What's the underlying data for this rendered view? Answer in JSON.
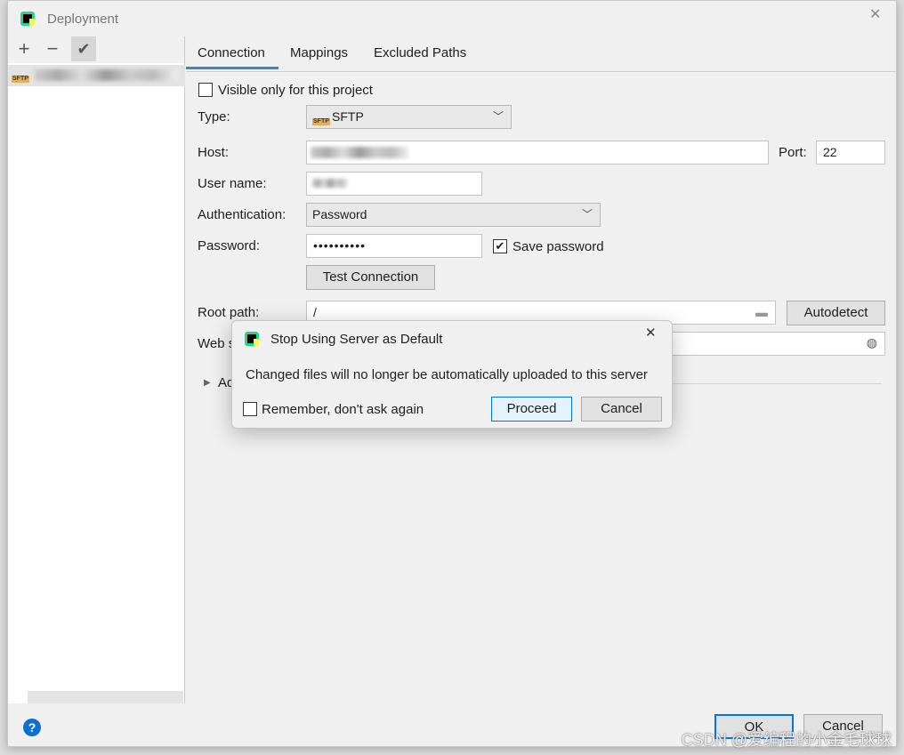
{
  "window": {
    "title": "Deployment",
    "close": "✕"
  },
  "toolbar": {
    "add": "+",
    "remove": "−",
    "default": "✔"
  },
  "server_list": {
    "items": [
      {
        "type_badge": "SFTP",
        "name": ""
      }
    ]
  },
  "tabs": [
    {
      "label": "Connection",
      "selected": true
    },
    {
      "label": "Mappings"
    },
    {
      "label": "Excluded Paths"
    }
  ],
  "form": {
    "visible_only": {
      "label": "Visible only for this project",
      "checked": false
    },
    "type": {
      "label": "Type:",
      "value": "SFTP",
      "badge": "SFTP"
    },
    "host": {
      "label": "Host:",
      "value": ""
    },
    "port": {
      "label": "Port:",
      "value": "22"
    },
    "username": {
      "label": "User name:",
      "value": ""
    },
    "auth": {
      "label": "Authentication:",
      "value": "Password"
    },
    "password": {
      "label": "Password:",
      "value": "••••••••••"
    },
    "save_password": {
      "label": "Save password",
      "checked": true
    },
    "test_connection": "Test Connection",
    "root_path": {
      "label": "Root path:",
      "value": "/"
    },
    "autodetect": "Autodetect",
    "web_server": {
      "label": "Web s"
    },
    "advanced": {
      "label": "Ad"
    }
  },
  "dialog": {
    "title": "Stop Using Server as Default",
    "message": "Changed files will no longer be automatically uploaded to this server",
    "remember": {
      "label": "Remember, don't ask again",
      "checked": false
    },
    "proceed": "Proceed",
    "cancel": "Cancel",
    "close": "✕"
  },
  "footer": {
    "help": "?",
    "ok": "OK",
    "cancel": "Cancel"
  },
  "watermark": "CSDN @爱编程的小金毛球球",
  "colors": {
    "accent": "#0078d7",
    "tab_underline": "#3d84c9"
  }
}
